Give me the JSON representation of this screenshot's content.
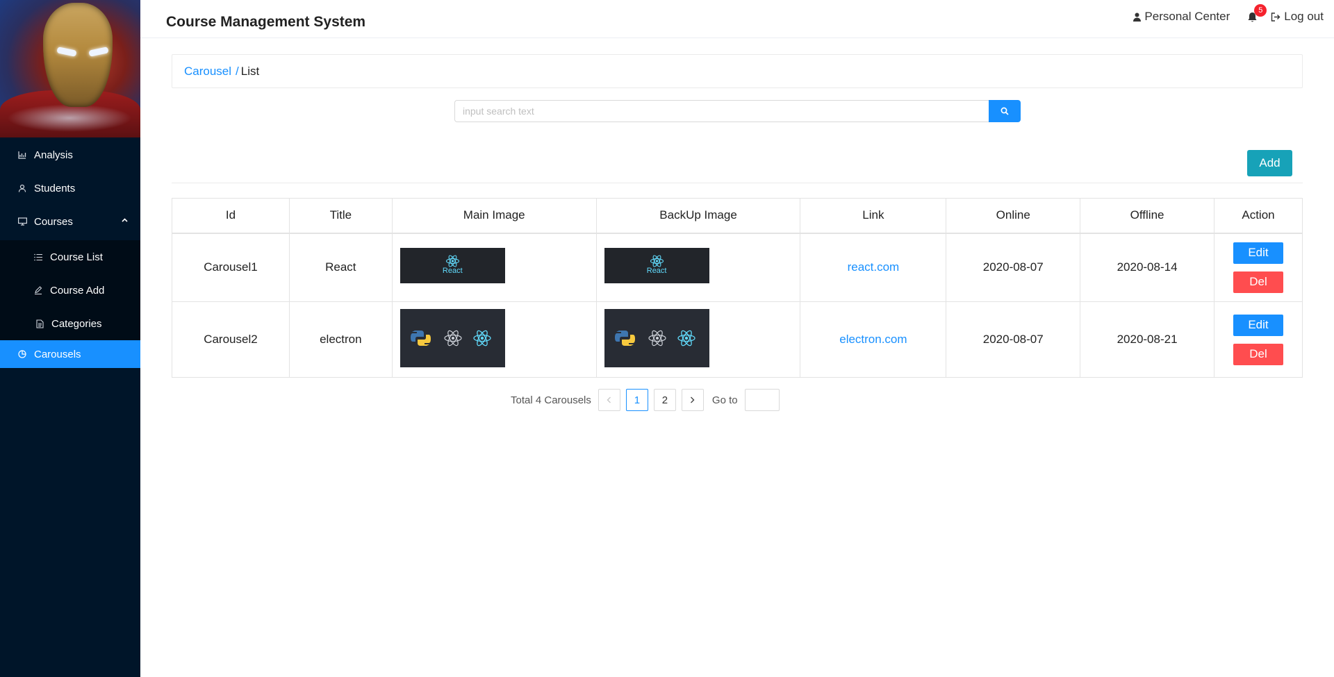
{
  "app": {
    "title": "Course Management System"
  },
  "header": {
    "personal_center": "Personal Center",
    "notification_count": "5",
    "logout": "Log out"
  },
  "sidebar": {
    "items": [
      {
        "label": "Analysis",
        "icon": "chart-icon"
      },
      {
        "label": "Students",
        "icon": "user-icon"
      },
      {
        "label": "Courses",
        "icon": "desktop-icon",
        "expanded": true
      },
      {
        "label": "Course List",
        "icon": "list-icon"
      },
      {
        "label": "Course Add",
        "icon": "edit-icon"
      },
      {
        "label": "Categories",
        "icon": "file-icon"
      },
      {
        "label": "Carousels",
        "icon": "pie-chart-icon",
        "active": true
      }
    ]
  },
  "breadcrumb": {
    "root": "Carousel",
    "separator": "/",
    "current": "List"
  },
  "search": {
    "placeholder": "input search text",
    "value": ""
  },
  "toolbar": {
    "add_label": "Add"
  },
  "table": {
    "columns": [
      "Id",
      "Title",
      "Main Image",
      "BackUp Image",
      "Link",
      "Online",
      "Offline",
      "Action"
    ],
    "rows": [
      {
        "id": "Carousel1",
        "title": "React",
        "main_image_text": "React",
        "backup_image_text": "React",
        "link": "react.com",
        "online": "2020-08-07",
        "offline": "2020-08-14",
        "edit_label": "Edit",
        "del_label": "Del"
      },
      {
        "id": "Carousel2",
        "title": "electron",
        "link": "electron.com",
        "online": "2020-08-07",
        "offline": "2020-08-21",
        "edit_label": "Edit",
        "del_label": "Del"
      }
    ]
  },
  "pagination": {
    "total_text": "Total 4 Carousels",
    "prev": "<",
    "next": ">",
    "pages": [
      "1",
      "2"
    ],
    "current_page": "1",
    "goto_label": "Go to",
    "goto_value": ""
  },
  "colors": {
    "sidebar_bg": "#001529",
    "accent": "#1890ff",
    "add_button": "#17a2b8",
    "danger": "#ff4d4f"
  }
}
